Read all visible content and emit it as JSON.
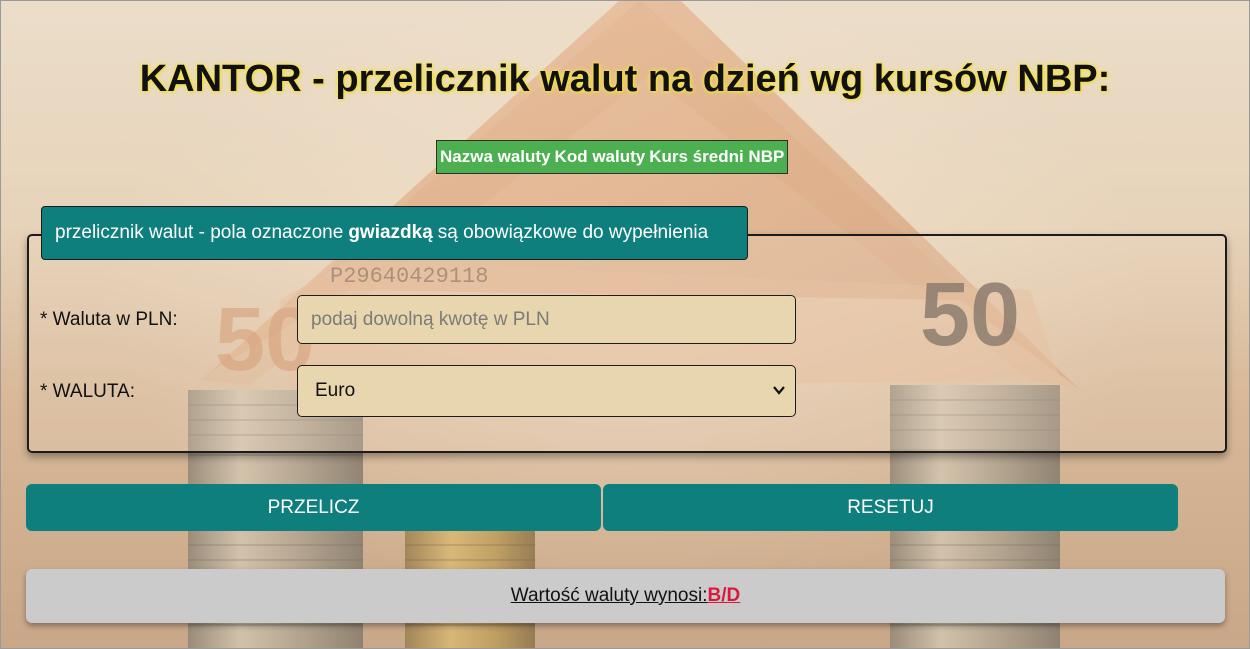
{
  "page": {
    "title": "KANTOR - przelicznik walut na dzień wg kursów NBP:"
  },
  "rates_table": {
    "headers": [
      "Nazwa waluty",
      "Kod waluty",
      "Kurs średni NBP"
    ]
  },
  "form": {
    "legend_prefix": "przelicznik walut - pola oznaczone",
    "legend_bold": "gwiazdką",
    "legend_suffix": "są obowiązkowe do wypełnienia",
    "amount_label": "* Waluta w PLN:",
    "amount_placeholder": "podaj dowolną kwotę w PLN",
    "currency_label": "* WALUTA:",
    "currency_selected": "Euro"
  },
  "buttons": {
    "calculate": "PRZELICZ",
    "reset": "RESETUJ"
  },
  "result": {
    "label": "Wartość waluty wynosi:",
    "value": "B/D"
  },
  "colors": {
    "teal": "#0e7f7d",
    "table_green": "#4caf50",
    "input_bg": "#e8d6ae",
    "result_value": "#d81b3c"
  }
}
